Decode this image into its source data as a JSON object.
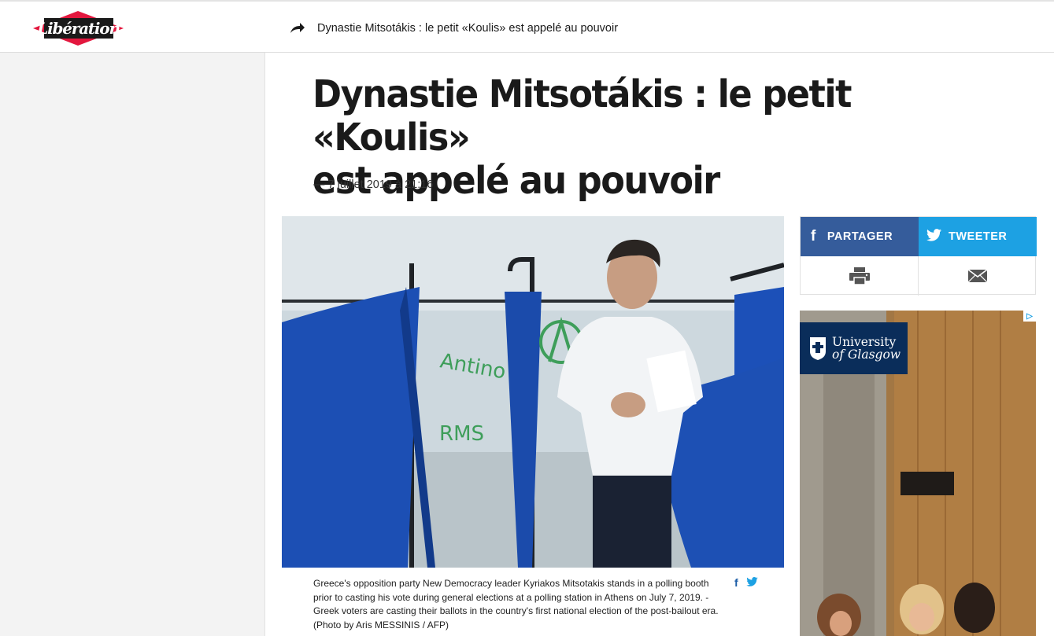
{
  "header": {
    "logo_text": "Libération",
    "article_title": "Dynastie Mitsotákis : le petit «Koulis» est appelé au pouvoir"
  },
  "article": {
    "headline_line1": "Dynastie Mitsotákis : le petit «Koulis»",
    "headline_line2": "est appelé au pouvoir",
    "dateline": "— 7 juillet 2019 à 21:16",
    "caption": "Greece's opposition party New Democracy leader Kyriakos Mitsotakis stands in a polling booth prior to casting his vote during general elections at a polling station in Athens on July 7, 2019. - Greek voters are casting their ballots in the country's first national election of the post-bailout era. (Photo by Aris MESSINIS / AFP)"
  },
  "share": {
    "facebook_label": "PARTAGER",
    "twitter_label": "TWEETER"
  },
  "ad": {
    "brand_line1": "University",
    "brand_line2": "of Glasgow"
  },
  "icons": {
    "share": "share-arrow-icon",
    "facebook": "facebook-icon",
    "twitter": "twitter-icon",
    "print": "printer-icon",
    "mail": "mail-icon",
    "adchoices": "adchoices-icon"
  },
  "colors": {
    "brand_red": "#e3173e",
    "facebook": "#355c9b",
    "twitter": "#1da1e3",
    "ad_navy": "#0a2d5a"
  }
}
